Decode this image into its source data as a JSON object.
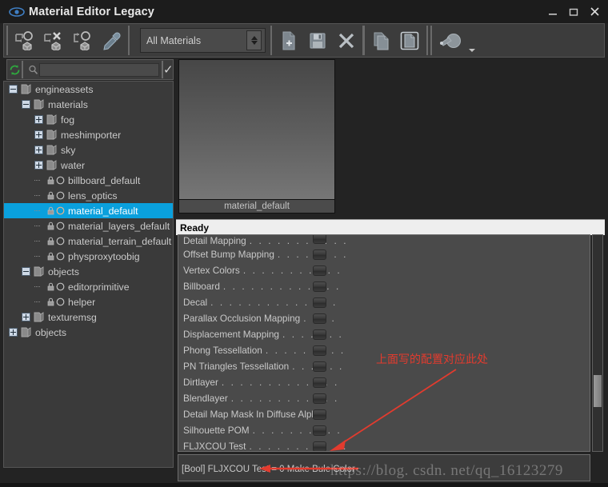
{
  "window": {
    "title": "Material Editor Legacy",
    "app_icon": "eye-icon",
    "minimize_label": "–",
    "maximize_label": "□",
    "close_label": "×"
  },
  "toolbar": {
    "buttons": [
      {
        "name": "assign-material-to-selection",
        "icon": "assign-material-icon"
      },
      {
        "name": "remove-material-from-selection",
        "icon": "remove-material-icon"
      },
      {
        "name": "get-material-from-selection",
        "icon": "get-material-icon"
      },
      {
        "name": "pick-material",
        "icon": "eyedropper-icon"
      }
    ],
    "filter": {
      "value": "All Materials",
      "options": [
        "All Materials"
      ]
    },
    "file_buttons": [
      {
        "name": "add-new-material",
        "icon": "new-file-icon"
      },
      {
        "name": "save-material",
        "icon": "save-floppy-icon"
      },
      {
        "name": "delete-material",
        "icon": "delete-x-icon"
      }
    ],
    "clipboard_buttons": [
      {
        "name": "copy-material",
        "icon": "copy-pages-icon"
      },
      {
        "name": "paste-material",
        "icon": "paste-page-icon"
      }
    ],
    "preview_buttons": [
      {
        "name": "material-preview-sphere",
        "icon": "sphere-preview-icon"
      }
    ]
  },
  "search": {
    "refresh_icon": "refresh-icon",
    "search_icon": "search-icon",
    "value": "",
    "placeholder": "",
    "apply_icon": "check-icon",
    "apply_label": "✓"
  },
  "tree": {
    "items": [
      {
        "label": "engineassets",
        "depth": 0,
        "toggle": "minus",
        "icon": "folder-icon",
        "selected": false
      },
      {
        "label": "materials",
        "depth": 1,
        "toggle": "minus",
        "icon": "folder-icon",
        "selected": false
      },
      {
        "label": "fog",
        "depth": 2,
        "toggle": "plus",
        "icon": "folder-icon",
        "selected": false
      },
      {
        "label": "meshimporter",
        "depth": 2,
        "toggle": "plus",
        "icon": "folder-icon",
        "selected": false
      },
      {
        "label": "sky",
        "depth": 2,
        "toggle": "plus",
        "icon": "folder-icon",
        "selected": false
      },
      {
        "label": "water",
        "depth": 2,
        "toggle": "plus",
        "icon": "folder-icon",
        "selected": false
      },
      {
        "label": "billboard_default",
        "depth": 2,
        "toggle": "none",
        "icon": "material-icon",
        "selected": false
      },
      {
        "label": "lens_optics",
        "depth": 2,
        "toggle": "none",
        "icon": "material-icon",
        "selected": false
      },
      {
        "label": "material_default",
        "depth": 2,
        "toggle": "none",
        "icon": "material-icon",
        "selected": true
      },
      {
        "label": "material_layers_default",
        "depth": 2,
        "toggle": "none",
        "icon": "material-icon",
        "selected": false
      },
      {
        "label": "material_terrain_default",
        "depth": 2,
        "toggle": "none",
        "icon": "material-icon",
        "selected": false
      },
      {
        "label": "physproxytoobig",
        "depth": 2,
        "toggle": "none",
        "icon": "material-icon",
        "selected": false
      },
      {
        "label": "objects",
        "depth": 1,
        "toggle": "minus",
        "icon": "folder-icon",
        "selected": false
      },
      {
        "label": "editorprimitive",
        "depth": 2,
        "toggle": "none",
        "icon": "material-icon",
        "selected": false
      },
      {
        "label": "helper",
        "depth": 2,
        "toggle": "none",
        "icon": "material-icon",
        "selected": false
      },
      {
        "label": "texturemsg",
        "depth": 1,
        "toggle": "plus",
        "icon": "folder-icon",
        "selected": false
      },
      {
        "label": "objects",
        "depth": 0,
        "toggle": "plus",
        "icon": "folder-icon",
        "selected": false
      }
    ]
  },
  "preview": {
    "caption": "material_default"
  },
  "status": {
    "ready_label": "Ready",
    "message": "[Bool] FLJXCOU Test = 0 Make Bule Color"
  },
  "properties": {
    "rows": [
      {
        "label": "Detail Mapping",
        "dots": ". . . . . . . . . . .",
        "checked": false,
        "clipped": true
      },
      {
        "label": "Offset Bump Mapping",
        "dots": ". . . . . . . .",
        "checked": false,
        "clipped": false
      },
      {
        "label": "Vertex Colors",
        "dots": ". . . . . . . . . . .",
        "checked": false,
        "clipped": false
      },
      {
        "label": "Billboard",
        "dots": ". . . . . . . . . . . . .",
        "checked": false,
        "clipped": false
      },
      {
        "label": "Decal",
        "dots": ". . . . . . . . . . . . . .",
        "checked": false,
        "clipped": false
      },
      {
        "label": "Parallax Occlusion Mapping",
        "dots": ". . . .",
        "checked": false,
        "clipped": false
      },
      {
        "label": "Displacement Mapping",
        "dots": ". . . . . . .",
        "checked": false,
        "clipped": false
      },
      {
        "label": "Phong Tessellation",
        "dots": ". . . . . . . . .",
        "checked": false,
        "clipped": false
      },
      {
        "label": "PN Triangles Tessellation",
        "dots": ". . . . . .",
        "checked": false,
        "clipped": false
      },
      {
        "label": "Dirtlayer",
        "dots": ". . . . . . . . . . . . .",
        "checked": false,
        "clipped": false
      },
      {
        "label": "Blendlayer",
        "dots": ". . . . . . . . . . . .",
        "checked": false,
        "clipped": false
      },
      {
        "label": "Detail Map Mask In Diffuse Alpha",
        "dots": "",
        "checked": false,
        "clipped": false
      },
      {
        "label": "Silhouette POM",
        "dots": ". . . . . . . . . .",
        "checked": false,
        "clipped": false
      },
      {
        "label": "FLJXCOU Test",
        "dots": ". . . . . . . . . . .",
        "checked": false,
        "clipped": false
      }
    ]
  },
  "annotation": {
    "text": "上面写的配置对应此处",
    "color": "#e23b2e"
  },
  "watermark": {
    "text": "https://blog. csdn. net/qq_16123279"
  },
  "colors": {
    "titlebar_bg": "#1c1c1c",
    "toolbar_bg": "#3c3c3c",
    "panel_bg": "#3a3a3a",
    "prop_bg": "#4a4a4a",
    "selection": "#0aa0dd",
    "text": "#c9c9c9",
    "ready_bg": "#eeeeee"
  }
}
